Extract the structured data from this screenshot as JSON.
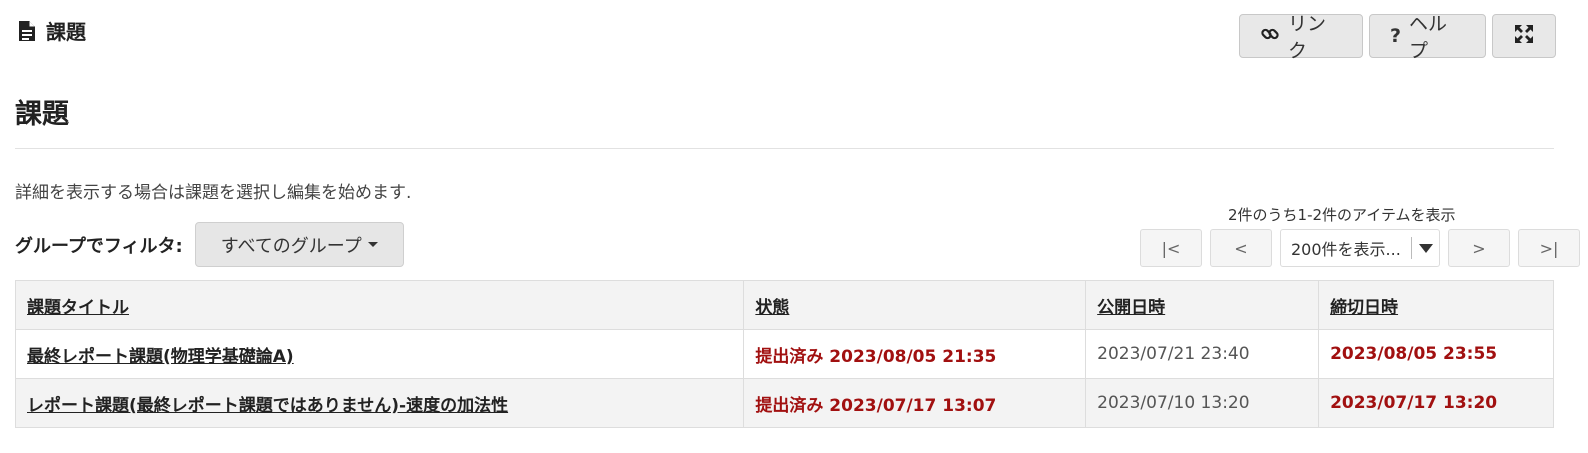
{
  "tool": {
    "title": "課題"
  },
  "actions": {
    "link_label": "リンク",
    "help_label": "ヘルプ"
  },
  "page": {
    "title": "課題",
    "instructions": "詳細を表示する場合は課題を選択し編集を始めます."
  },
  "filter": {
    "label": "グループでフィルタ:",
    "selected": "すべてのグループ"
  },
  "pager": {
    "info": "2件のうち1-2件のアイテムを表示",
    "first": "|<",
    "prev": "<",
    "page_size": "200件を表示...",
    "next": ">",
    "last": ">|"
  },
  "table": {
    "headers": [
      "課題タイトル",
      "状態",
      "公開日時",
      "締切日時"
    ],
    "rows": [
      {
        "title": "最終レポート課題(物理学基礎論A)",
        "status": "提出済み 2023/08/05 21:35",
        "open": "2023/07/21 23:40",
        "due": "2023/08/05 23:55"
      },
      {
        "title": "レポート課題(最終レポート課題ではありません)-速度の加法性",
        "status": "提出済み 2023/07/17 13:07",
        "open": "2023/07/10 13:20",
        "due": "2023/07/17 13:20"
      }
    ]
  },
  "colors": {
    "status_red": "#a11010",
    "header_bg": "#f3f3f3",
    "button_bg": "#e8e8e8"
  }
}
